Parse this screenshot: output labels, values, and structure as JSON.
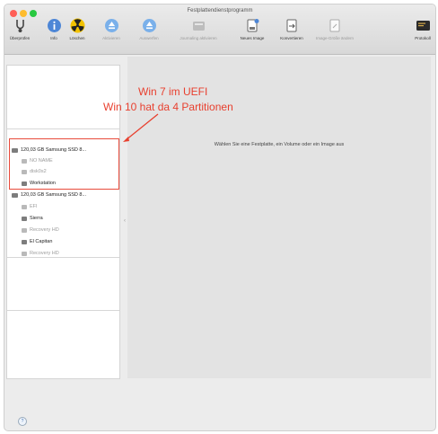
{
  "window": {
    "title": "Festplattendienstprogramm",
    "traffic_colors": [
      "#ff5f57",
      "#febc2e",
      "#28c840"
    ]
  },
  "toolbar": {
    "items": [
      {
        "label": "Überprüfen",
        "icon": "stethoscope-icon",
        "enabled": true
      },
      {
        "label": "Info",
        "icon": "info-icon",
        "enabled": true
      },
      {
        "label": "Löschen",
        "icon": "erase-icon",
        "enabled": true
      },
      {
        "label": "Aktivieren",
        "icon": "mount-icon",
        "enabled": false
      },
      {
        "label": "Auswerfen",
        "icon": "eject-icon",
        "enabled": false
      },
      {
        "label": "Journaling aktivieren",
        "icon": "journal-disk-icon",
        "enabled": false
      },
      {
        "label": "Neues Image",
        "icon": "new-image-icon",
        "enabled": true
      },
      {
        "label": "Konvertieren",
        "icon": "convert-icon",
        "enabled": true
      },
      {
        "label": "Image-Größe ändern",
        "icon": "resize-image-icon",
        "enabled": false
      },
      {
        "label": "Protokoll",
        "icon": "log-icon",
        "enabled": true
      }
    ]
  },
  "sidebar": {
    "disks": [
      {
        "name": "120,03 GB Samsung SSD 8...",
        "volumes": [
          {
            "name": "NO NAME",
            "mounted": false
          },
          {
            "name": "disk0s2",
            "mounted": false
          },
          {
            "name": "Workstation",
            "mounted": true
          }
        ]
      },
      {
        "name": "120,03 GB Samsung SSD 8...",
        "volumes": [
          {
            "name": "EFI",
            "mounted": false
          },
          {
            "name": "Sierra",
            "mounted": true
          },
          {
            "name": "Recovery HD",
            "mounted": false
          },
          {
            "name": "El Capitan",
            "mounted": true
          },
          {
            "name": "Recovery HD",
            "mounted": false
          }
        ]
      }
    ]
  },
  "main": {
    "message": "Wählen Sie eine Festplatte, ein Volume oder ein Image aus"
  },
  "annotation": {
    "line1": "Win 7 im UEFI",
    "line2": "Win 10 hat da 4 Partitionen",
    "color": "#e8402f"
  },
  "footer": {
    "help_label": "?"
  }
}
